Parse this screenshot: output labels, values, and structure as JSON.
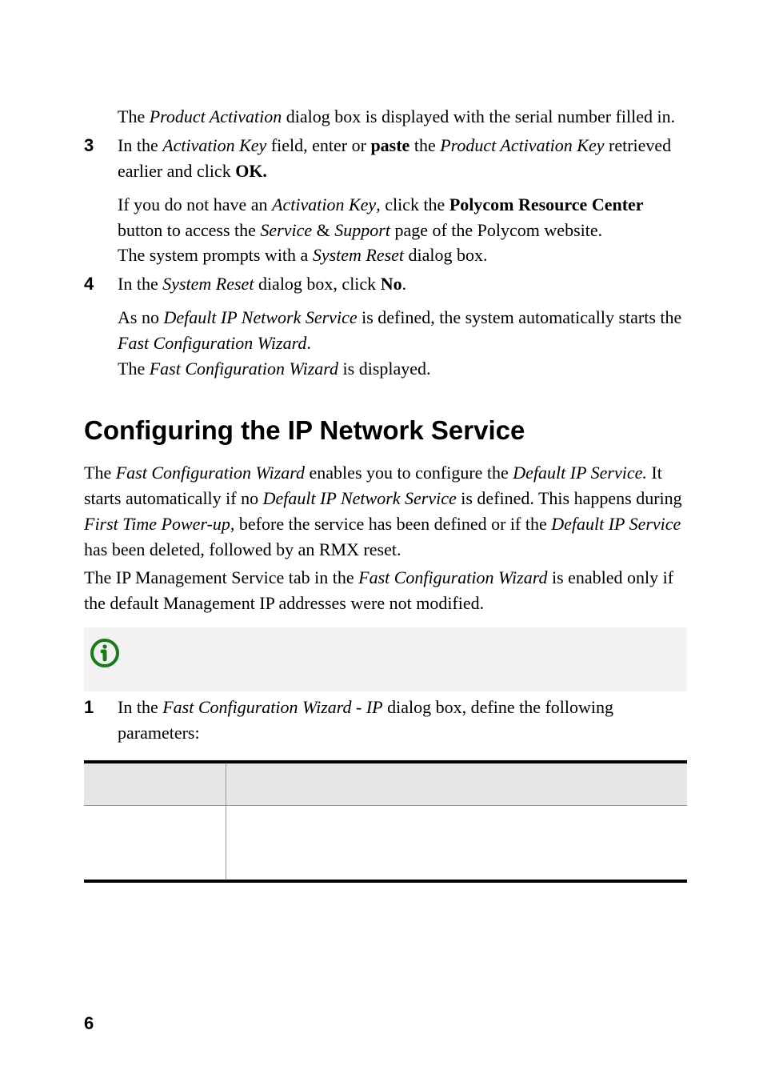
{
  "intro": {
    "p1_before_italic": "The ",
    "p1_italic": "Product Activation",
    "p1_after_italic": " dialog box is displayed with the serial number filled in."
  },
  "step3": {
    "num": "3",
    "line1": {
      "t1": "In the ",
      "i1": "Activation Key",
      "t2": " field, enter or ",
      "b1": "paste",
      "t3": " the ",
      "i2": "Product Activation Key",
      "t4": " retrieved earlier and click ",
      "b2": "OK."
    },
    "line2": {
      "t1": "If you do not have an ",
      "i1": "Activation Key",
      "t2": ", click the ",
      "b1": "Polycom Resource Center",
      "t3": " button to access the ",
      "i2": "Service",
      "t4": " & ",
      "i3": "Support",
      "t5": " page of the Polycom website."
    },
    "line3": {
      "t1": "The system prompts with a ",
      "i1": "System Reset",
      "t2": " dialog box."
    }
  },
  "step4": {
    "num": "4",
    "line1": {
      "t1": "In the ",
      "i1": "System Reset",
      "t2": " dialog box, click ",
      "b1": "No",
      "t3": "."
    },
    "line2": {
      "t1": "As no ",
      "i1": "Default IP Network Service",
      "t2": " is defined, the system automatically starts the ",
      "i2": "Fast Configuration Wizard",
      "t3": "."
    },
    "line3": {
      "t1": "The ",
      "i1": "Fast Configuration Wizard",
      "t2": " is displayed."
    }
  },
  "section": {
    "heading": "Configuring the IP Network Service",
    "para1": {
      "t1": "The ",
      "i1": "Fast Configuration Wizard",
      "t2": " enables you to configure the ",
      "i2": "Default IP Service.",
      "t3": " It starts automatically if no ",
      "i3": "Default IP Network Service",
      "t4": " is defined. This happens during ",
      "i4": "First Time Power-up",
      "t5": ", before the service has been defined or if the ",
      "i5": "Default IP Service",
      "t6": " has been deleted, followed by an RMX reset."
    },
    "para2": {
      "t1": "The IP Management Service tab in the ",
      "i1": "Fast Configuration Wizard",
      "t2": " is enabled only if the default Management IP addresses were not modified."
    }
  },
  "step1": {
    "num": "1",
    "line1": {
      "t1": "In the ",
      "i1": "Fast Configuration Wizard",
      "t2": " - ",
      "i2": "IP",
      "t3": " dialog box, define the following parameters:"
    }
  },
  "pageNumber": "6"
}
